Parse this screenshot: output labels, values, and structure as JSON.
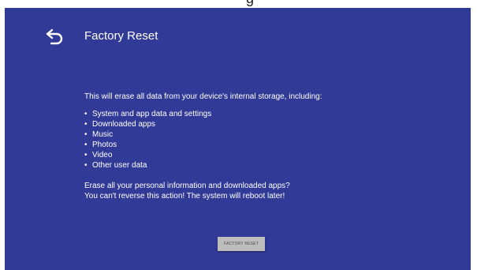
{
  "page": {
    "title": "Factory Reset",
    "back_icon": "back-arrow-icon",
    "intro": "This will erase all data from your device's internal storage, including:",
    "bullet_char": "•",
    "items": [
      "System and app data and settings",
      "Downloaded apps",
      "Music",
      "Photos",
      "Video",
      "Other user data"
    ],
    "warning_line1": "Erase all your personal information and downloaded apps?",
    "warning_line2": "You can't reverse this action! The system will reboot later!",
    "button_label": "FACTORY RESET"
  },
  "colors": {
    "background": "#313a96",
    "text": "#ffffff",
    "button_bg": "#bdbdbd",
    "button_text": "#4a4a4a"
  }
}
